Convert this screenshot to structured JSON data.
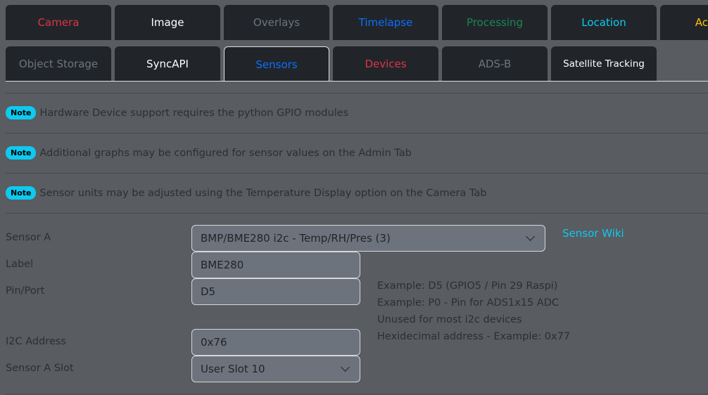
{
  "tabs_row1": [
    {
      "label": "Camera",
      "color": "#dc3545"
    },
    {
      "label": "Image",
      "color": "#ffffff"
    },
    {
      "label": "Overlays",
      "color": "#6c757d"
    },
    {
      "label": "Timelapse",
      "color": "#0d6efd"
    },
    {
      "label": "Processing",
      "color": "#198754"
    },
    {
      "label": "Location",
      "color": "#0dcaf0"
    },
    {
      "label": "Ac",
      "color": "#ffc107"
    }
  ],
  "tabs_row2": [
    {
      "label": "Object Storage",
      "color": "#6c757d"
    },
    {
      "label": "SyncAPI",
      "color": "#ffffff"
    },
    {
      "label": "Sensors",
      "color": "#0d6efd",
      "active": true
    },
    {
      "label": "Devices",
      "color": "#dc3545"
    },
    {
      "label": "ADS-B",
      "color": "#6c757d"
    },
    {
      "label": "Satellite Tracking",
      "color": "#ffffff"
    }
  ],
  "notes": {
    "badge": "Note",
    "items": [
      "Hardware Device support requires the python GPIO modules",
      "Additional graphs may be configured for sensor values on the Admin Tab",
      "Sensor units may be adjusted using the Temperature Display option on the Camera Tab"
    ]
  },
  "form": {
    "sensor_label": "Sensor A",
    "sensor_value": "BMP/BME280 i2c - Temp/RH/Pres (3)",
    "wiki": "Sensor Wiki",
    "label_label": "Label",
    "label_value": "BME280",
    "pin_label": "Pin/Port",
    "pin_value": "D5",
    "i2c_label": "I2C Address",
    "i2c_value": "0x76",
    "slot_label": "Sensor A Slot",
    "slot_value": "User Slot 10",
    "help": [
      "Example: D5 (GPIO5 / Pin 29 Raspi)",
      "Example: P0 - Pin for ADS1x15 ADC",
      "Unused for most i2c devices",
      "Hexidecimal address - Example: 0x77"
    ]
  }
}
